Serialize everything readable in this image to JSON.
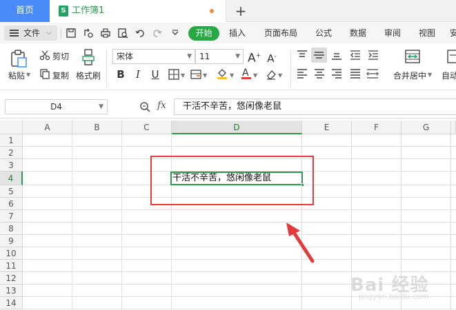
{
  "tabs": {
    "home": "首页",
    "doc_icon": "S",
    "doc_title": "工作簿1",
    "add": "+"
  },
  "menu": {
    "file": "文件",
    "start": "开始",
    "items": [
      "插入",
      "页面布局",
      "公式",
      "数据",
      "审阅",
      "视图",
      "安"
    ]
  },
  "ribbon": {
    "paste": "粘贴",
    "cut": "剪切",
    "copy": "复制",
    "format_painter": "格式刷",
    "font_name": "宋体",
    "font_size": "11",
    "merge_center": "合并居中",
    "wrap": "自动"
  },
  "formula_bar": {
    "name_box": "D4",
    "fx": "fx",
    "content": "干活不辛苦，悠闲像老鼠"
  },
  "grid": {
    "columns": [
      "A",
      "B",
      "C",
      "D",
      "E",
      "F",
      "G"
    ],
    "rows": [
      "1",
      "2",
      "3",
      "4",
      "5",
      "6",
      "7",
      "8",
      "9",
      "10",
      "11",
      "12",
      "13",
      "14"
    ],
    "active_column": "D",
    "active_row": "4",
    "cell_d4": "干活不辛苦，悠闲像老鼠"
  },
  "watermark": {
    "brand": "Bai 经验",
    "sub": "jingyan.baidu.com"
  },
  "colors": {
    "accent_green": "#2a9a4c",
    "start_button": "#28a745",
    "home_tab": "#4a8cf7",
    "annotation_red": "#e23b3b"
  }
}
